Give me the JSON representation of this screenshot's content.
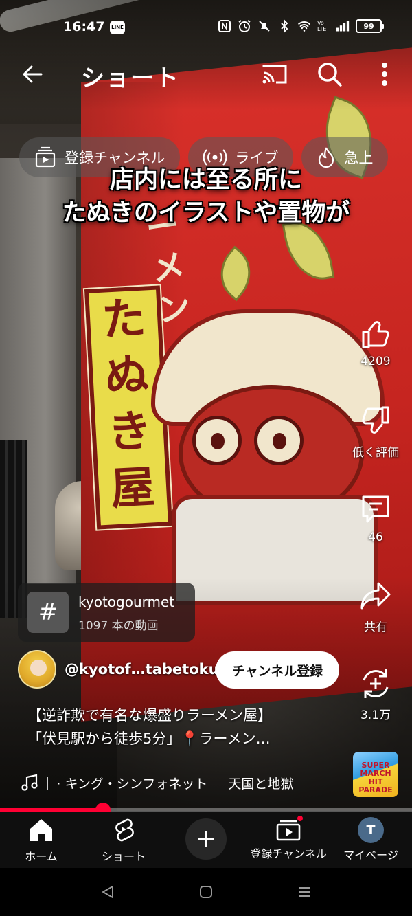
{
  "status_bar": {
    "time": "16:47",
    "line_badge": "LINE",
    "network": "Vo LTE",
    "battery": "99"
  },
  "app_bar": {
    "title": "ショート",
    "icons": [
      "back-arrow-icon",
      "cast-icon",
      "search-icon",
      "more-vert-icon"
    ]
  },
  "chips": [
    {
      "label": "登録チャンネル",
      "icon": "subscriptions-icon"
    },
    {
      "label": "ライブ",
      "icon": "live-icon"
    },
    {
      "label": "急上",
      "icon": "trending-icon"
    }
  ],
  "caption": {
    "line1": "店内には至る所に",
    "line2": "たぬきのイラストや置物が"
  },
  "actions": {
    "like_count": "4209",
    "dislike_label": "低く評価",
    "comment_count": "46",
    "share_label": "共有",
    "remix_count": "3.1万"
  },
  "hashtag": {
    "name": "kyotogourmet",
    "video_count": "1097 本の動画"
  },
  "channel": {
    "handle": "@kyotof…tabetoku",
    "subscribe_label": "チャンネル登録"
  },
  "video": {
    "title_line1": "【逆詐欺で有名な爆盛りラーメン屋】",
    "title_line2": "「伏見駅から徒歩5分」📍ラーメン…"
  },
  "music": {
    "separator": "|",
    "track1": "· キング・シンフォネット",
    "track2": "天国と地獄",
    "album_art_text": "SUPER MARCH HIT PARADE"
  },
  "progress": {
    "fraction": 0.25
  },
  "bottom_nav": {
    "home": "ホーム",
    "shorts": "ショート",
    "subscriptions": "登録チャンネル",
    "account": "マイページ",
    "account_initial": "T"
  },
  "scene_text": {
    "shop_name": [
      "た",
      "ぬ",
      "き",
      "屋"
    ],
    "ramen": [
      "ー",
      "メ",
      "ン"
    ]
  },
  "colors": {
    "accent": "#ff0033",
    "banner_red": "#c62520",
    "sign_yellow": "#e9dc4a"
  }
}
